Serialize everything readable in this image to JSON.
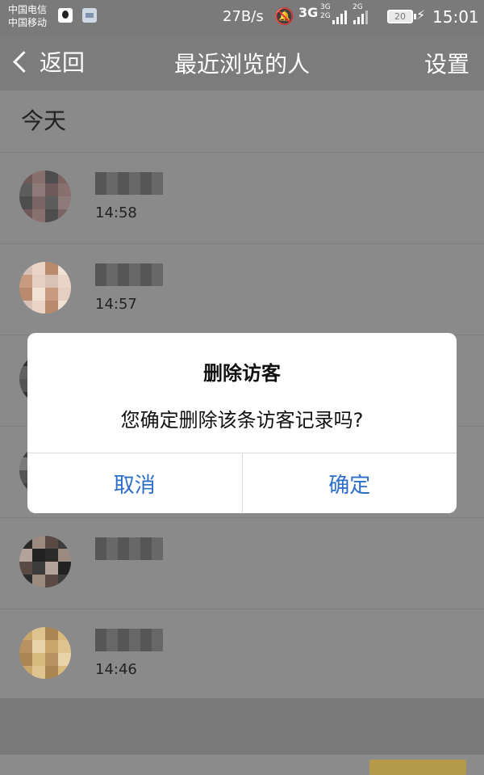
{
  "status_bar": {
    "carrier1": "中国电信",
    "carrier2": "中国移动",
    "icons": [
      "qq-icon",
      "image-notification-icon"
    ],
    "speed": "27B/s",
    "network": "3G",
    "dual_top": "3G",
    "dual_bottom": "2G",
    "second_network": "2G",
    "battery_level": "20",
    "charging_icon": "⚡",
    "time": "15:01"
  },
  "nav": {
    "back_label": "返回",
    "title": "最近浏览的人",
    "settings_label": "设置"
  },
  "section": {
    "today_label": "今天"
  },
  "visitors": [
    {
      "time": "14:58",
      "avatar_colors": [
        "#6f5858",
        "#8a6f6f",
        "#4d4d4d",
        "#7a6464",
        "#5c5c5c",
        "#8f7a7a"
      ]
    },
    {
      "time": "14:57",
      "avatar_colors": [
        "#d8c2b8",
        "#e9d4c6",
        "#b98a6e",
        "#f1e2d5",
        "#c89a80",
        "#e6cfc0"
      ]
    },
    {
      "time": "",
      "avatar_colors": [
        "#333333",
        "#4a4a4a",
        "#555555",
        "#3c3c3c",
        "#606060",
        "#2f2f2f"
      ]
    },
    {
      "time": "",
      "avatar_colors": [
        "#444444",
        "#666666",
        "#555555",
        "#3a3a3a",
        "#7a7a7a",
        "#2e2e2e"
      ]
    },
    {
      "time": "",
      "avatar_colors": [
        "#2a2a2a",
        "#9a8a80",
        "#5a4a44",
        "#3c3c3c",
        "#b4a39a",
        "#222222"
      ]
    },
    {
      "time": "14:46",
      "avatar_colors": [
        "#c9a66b",
        "#e0c48f",
        "#a98652",
        "#d8b97e",
        "#b89260",
        "#e8d2a8"
      ]
    }
  ],
  "dialog": {
    "title": "删除访客",
    "message": "您确定删除该条访客记录吗?",
    "cancel_label": "取消",
    "confirm_label": "确定",
    "button_color": "#2d6ec9"
  }
}
